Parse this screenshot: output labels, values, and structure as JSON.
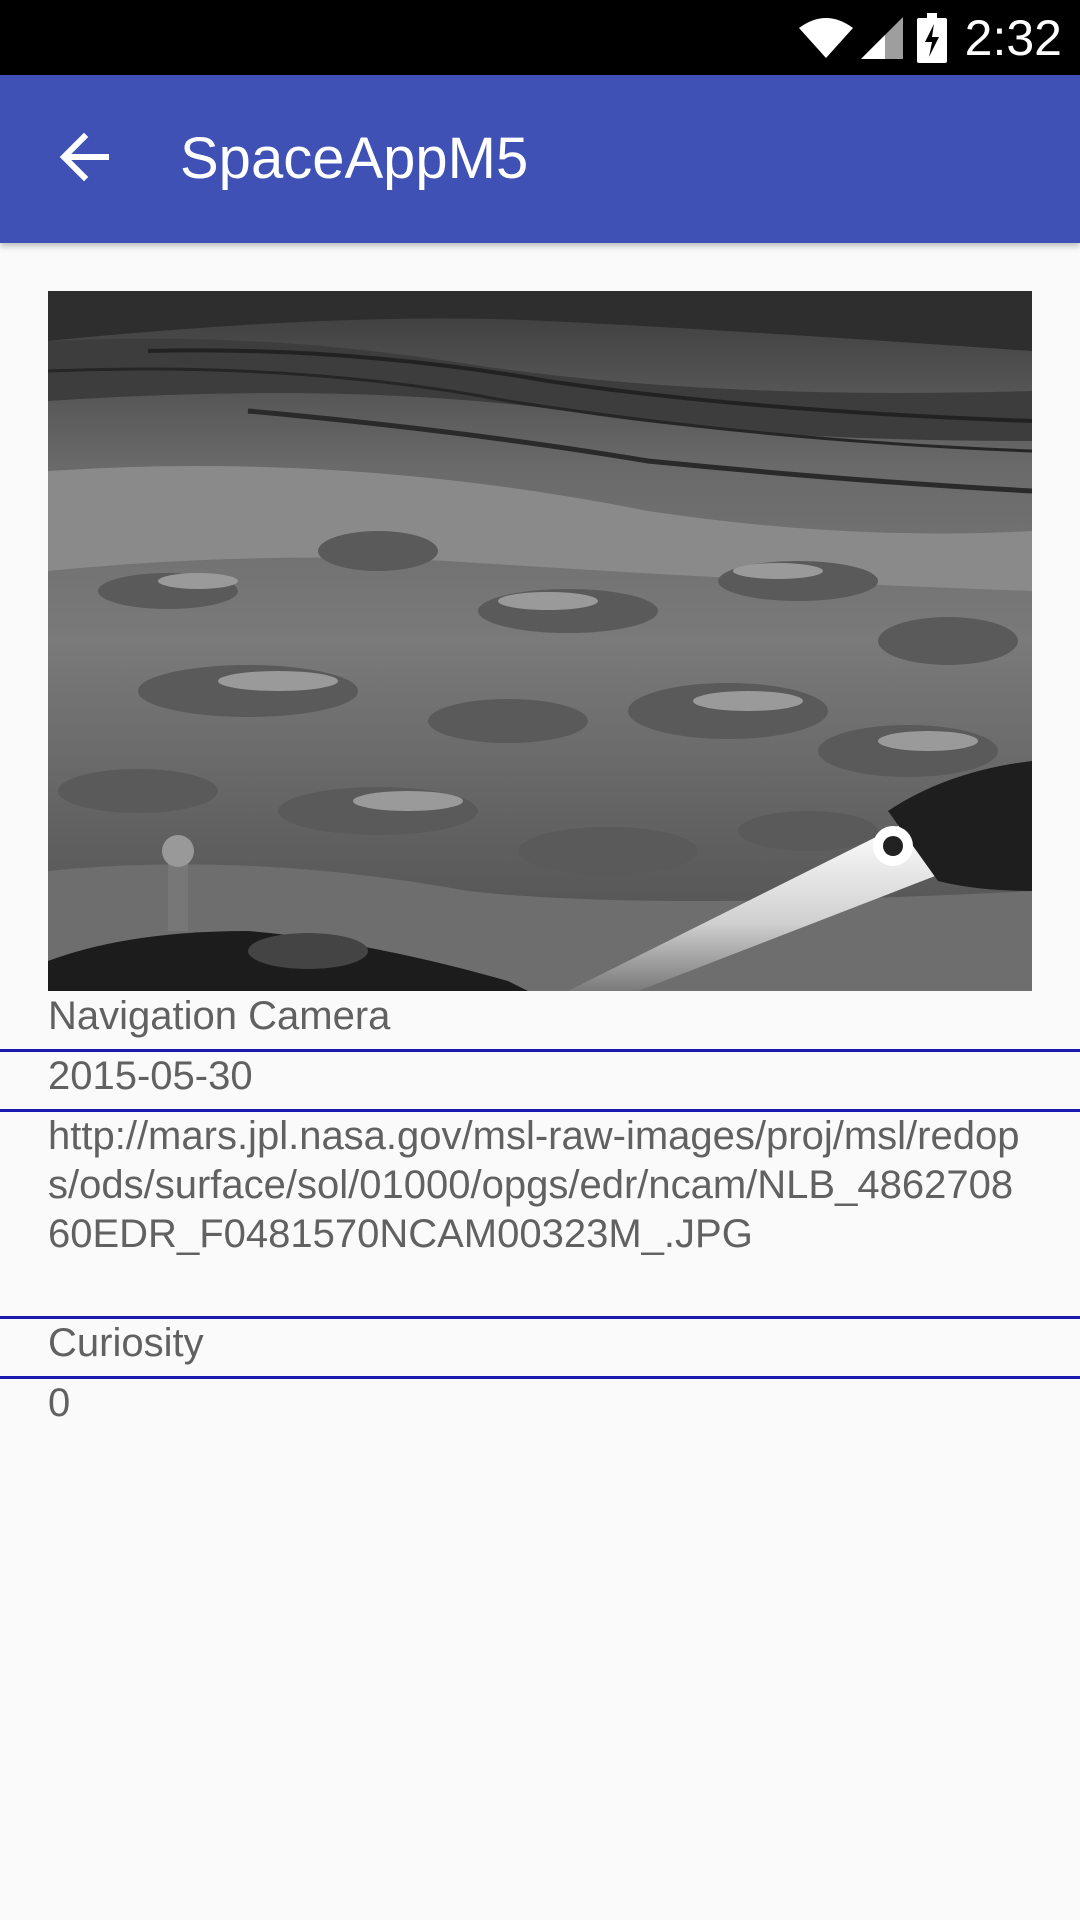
{
  "status_bar": {
    "time": "2:32",
    "icons": [
      "wifi-icon",
      "signal-icon",
      "battery-charging-icon"
    ]
  },
  "app_bar": {
    "title": "SpaceAppM5",
    "back_icon": "arrow-left-icon",
    "color": "#3f51b5"
  },
  "photo": {
    "description_icon": "mars-surface-image"
  },
  "details": {
    "camera": "Navigation Camera",
    "earth_date": "2015-05-30",
    "img_src": "http://mars.jpl.nasa.gov/msl-raw-images/proj/msl/redops/ods/surface/sol/01000/opgs/edr/ncam/NLB_486270860EDR_F0481570NCAM00323M_.JPG",
    "rover": "Curiosity",
    "extra": "0"
  },
  "colors": {
    "divider": "#1a1ab0",
    "text": "#616161",
    "background": "#fafafa"
  }
}
